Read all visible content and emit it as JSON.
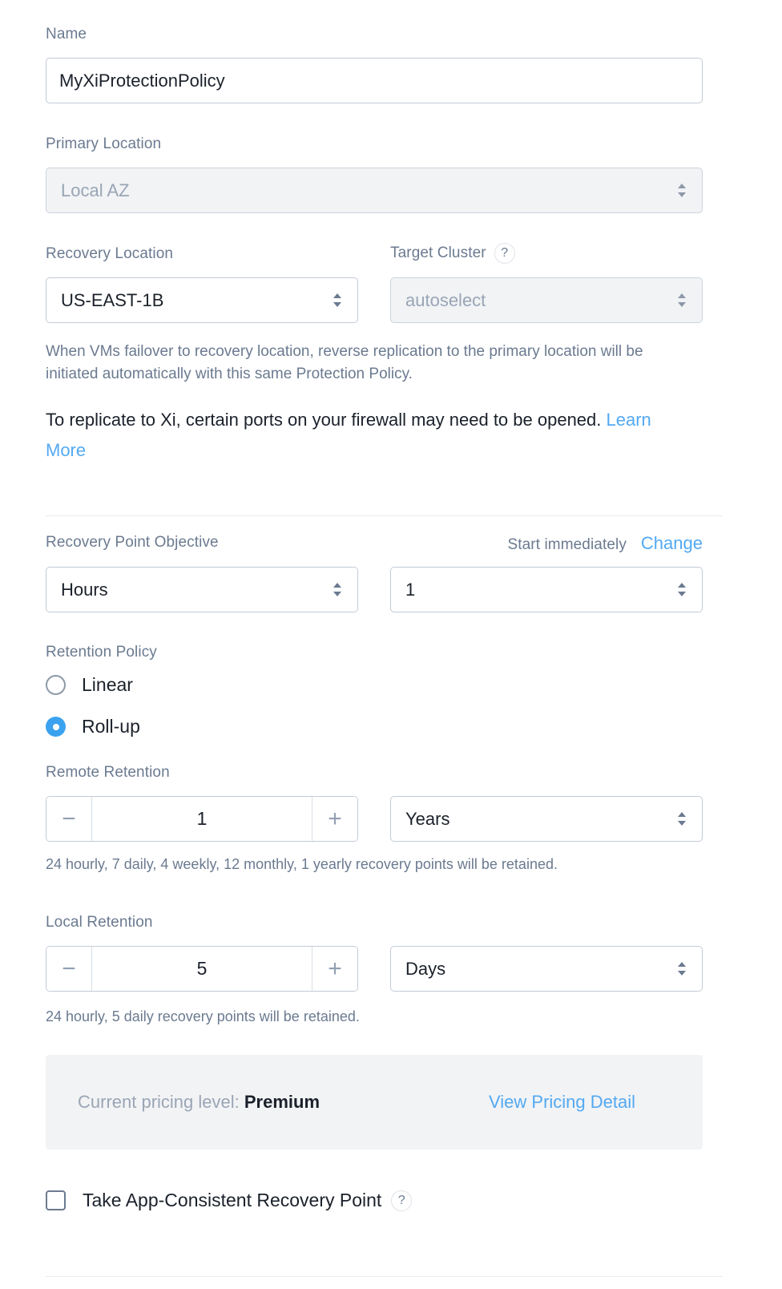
{
  "form": {
    "name": {
      "label": "Name",
      "value": "MyXiProtectionPolicy"
    },
    "primary_location": {
      "label": "Primary Location",
      "value": "Local AZ",
      "disabled": true
    },
    "recovery_location": {
      "label": "Recovery Location",
      "value": "US-EAST-1B"
    },
    "target_cluster": {
      "label": "Target Cluster",
      "help_icon": "question-mark-icon",
      "help_glyph": "?",
      "value": "autoselect",
      "disabled": true
    },
    "failover_note": "When VMs failover to recovery location, reverse replication to the primary location will be initiated automatically with this same Protection Policy.",
    "firewall_note": {
      "text": "To replicate to Xi, certain ports on your firewall may need to be opened.",
      "link_label": "Learn More"
    },
    "rpo": {
      "label": "Recovery Point Objective",
      "unit_value": "Hours",
      "count_value": "1",
      "schedule_text": "Start immediately",
      "change_link": "Change"
    },
    "retention_policy": {
      "label": "Retention Policy",
      "options": [
        {
          "label": "Linear",
          "selected": false
        },
        {
          "label": "Roll-up",
          "selected": true
        }
      ]
    },
    "remote_retention": {
      "label": "Remote Retention",
      "minus_glyph": "−",
      "plus_glyph": "+",
      "value": "1",
      "unit": "Years",
      "helper": "24 hourly, 7 daily, 4 weekly, 12 monthly, 1 yearly recovery points will be retained."
    },
    "local_retention": {
      "label": "Local Retention",
      "minus_glyph": "−",
      "plus_glyph": "+",
      "value": "5",
      "unit": "Days",
      "helper": "24 hourly, 5 daily recovery points will be retained."
    },
    "pricing": {
      "prefix": "Current pricing level:",
      "level": "Premium",
      "link_label": "View Pricing Detail"
    },
    "app_consistent": {
      "label": "Take App-Consistent Recovery Point",
      "checked": false,
      "help_icon": "question-mark-icon",
      "help_glyph": "?"
    }
  },
  "colors": {
    "link": "#53a9f2",
    "label": "#6b7a90",
    "value": "#1b212b",
    "border": "#c3cbd6",
    "disabled_bg": "#f1f3f5",
    "radio_selected": "#3ba2ef",
    "pricing_bg": "#f2f3f5",
    "divider": "#ececee"
  }
}
